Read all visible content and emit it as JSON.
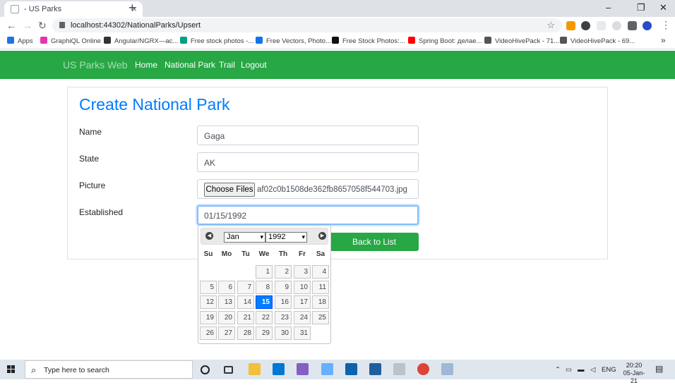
{
  "browser": {
    "tab_title": "- US Parks",
    "tab_close": "×",
    "new_tab": "+",
    "window_buttons": [
      "–",
      "❐",
      "✕"
    ],
    "url": "localhost:44302/NationalParks/Upsert",
    "star": "☆",
    "bookmarks": [
      {
        "label": "Apps",
        "color": "#1a73e8"
      },
      {
        "label": "GraphiQL Online",
        "color": "#e535ab"
      },
      {
        "label": "Angular/NGRX—ac...",
        "color": "#333333"
      },
      {
        "label": "Free stock photos -...",
        "color": "#05a081"
      },
      {
        "label": "Free Vectors, Photo...",
        "color": "#1273eb"
      },
      {
        "label": "Free Stock Photos:...",
        "color": "#111111"
      },
      {
        "label": "Spring Boot: делае...",
        "color": "#ff0000"
      },
      {
        "label": "VideoHivePack - 71...",
        "color": "#555555"
      },
      {
        "label": "VideoHivePack - 69...",
        "color": "#555555"
      }
    ],
    "more_bookmarks": "»"
  },
  "site": {
    "brand": "US Parks Web",
    "nav": [
      "Home",
      "National Park",
      "Trail",
      "Logout"
    ],
    "accent": "#28a745"
  },
  "form": {
    "title": "Create National Park",
    "name_label": "Name",
    "name_value": "Gaga",
    "state_label": "State",
    "state_value": "AK",
    "picture_label": "Picture",
    "choose_files": "Choose Files",
    "file_name": "af02c0b1508de362fb8657058f544703.jpg",
    "established_label": "Established",
    "established_value": "01/15/1992",
    "back_button": "Back to List"
  },
  "datepicker": {
    "month": "Jan",
    "year": "1992",
    "prev": "◀",
    "next": "▶",
    "dropdown_arrow": "▾",
    "days_of_week": [
      "Su",
      "Mo",
      "Tu",
      "We",
      "Th",
      "Fr",
      "Sa"
    ],
    "weeks": [
      [
        "",
        "",
        "",
        "1",
        "2",
        "3",
        "4"
      ],
      [
        "5",
        "6",
        "7",
        "8",
        "9",
        "10",
        "11"
      ],
      [
        "12",
        "13",
        "14",
        "15",
        "16",
        "17",
        "18"
      ],
      [
        "19",
        "20",
        "21",
        "22",
        "23",
        "24",
        "25"
      ],
      [
        "26",
        "27",
        "28",
        "29",
        "30",
        "31",
        ""
      ]
    ],
    "selected_day": "15"
  },
  "taskbar": {
    "search_placeholder": "Type here to search",
    "language": "ENG",
    "time": "20:20",
    "date": "05-Jan-21"
  }
}
